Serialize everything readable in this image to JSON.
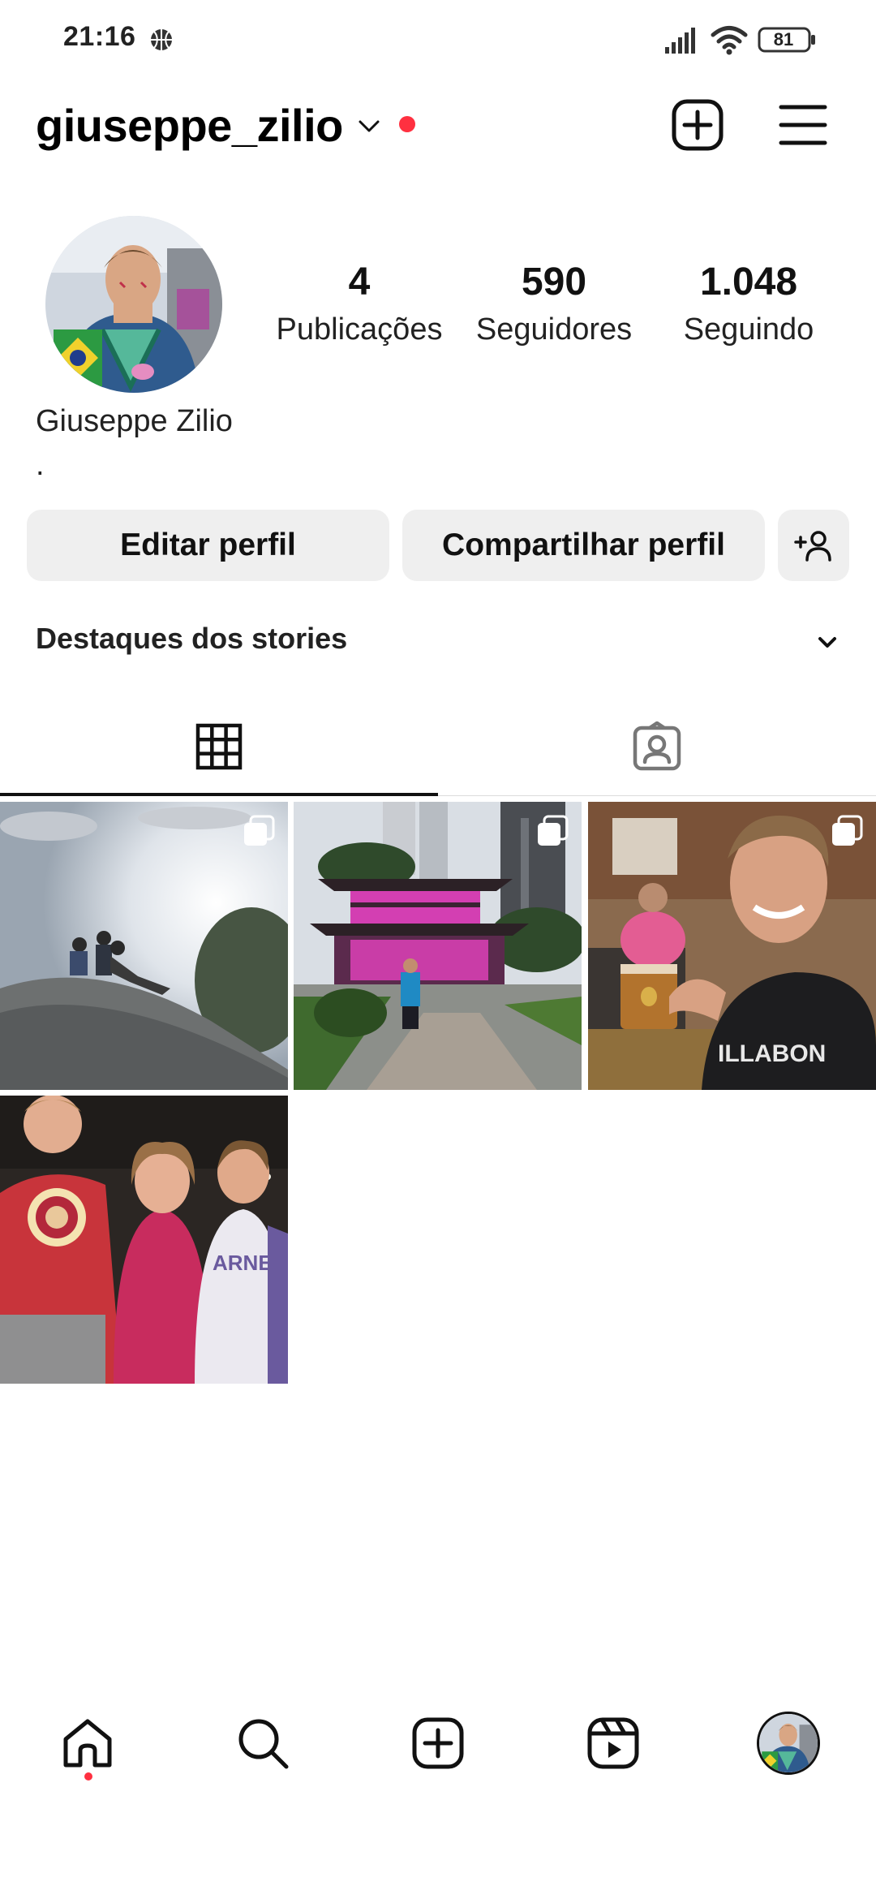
{
  "status_bar": {
    "time": "21:16",
    "battery": "81",
    "icons": [
      "basketball-icon",
      "signal-icon",
      "wifi-icon",
      "battery-icon"
    ]
  },
  "header": {
    "username": "giuseppe_zilio",
    "icons": [
      "chevron-down-icon",
      "new-post-icon",
      "menu-icon"
    ],
    "notification_color": "#ff3040"
  },
  "profile": {
    "stats": [
      {
        "value": "4",
        "label": "Publicações"
      },
      {
        "value": "590",
        "label": "Seguidores"
      },
      {
        "value": "1.048",
        "label": "Seguindo"
      }
    ],
    "full_name": "Giuseppe Zilio",
    "bio": "."
  },
  "actions": {
    "edit_label": "Editar perfil",
    "share_label": "Compartilhar perfil",
    "discover_icon": "add-person-icon"
  },
  "highlights": {
    "label": "Destaques dos stories"
  },
  "tabs": [
    {
      "icon": "grid-icon",
      "active": true
    },
    {
      "icon": "tagged-icon",
      "active": false
    }
  ],
  "posts": [
    {
      "description": "people sitting on rock at sunset",
      "multiple": true
    },
    {
      "description": "man in front of pink-lit pagoda",
      "multiple": true
    },
    {
      "description": "smiling man holding a drink",
      "multiple": true
    },
    {
      "description": "three friends posing at night",
      "multiple": false
    }
  ],
  "bottom_nav": {
    "items": [
      "home-icon",
      "search-icon",
      "create-icon",
      "reels-icon",
      "profile-avatar"
    ],
    "active": "home-icon"
  }
}
